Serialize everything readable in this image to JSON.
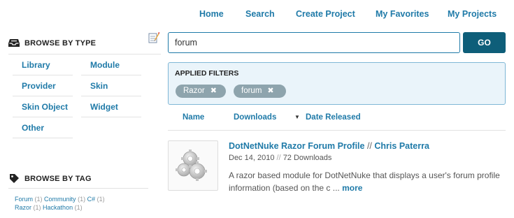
{
  "nav": {
    "home": "Home",
    "search": "Search",
    "create_project": "Create Project",
    "my_favorites": "My Favorites",
    "my_projects": "My Projects"
  },
  "sidebar": {
    "browse_by_type": "BROWSE BY TYPE",
    "types": [
      "Library",
      "Module",
      "Provider",
      "Skin",
      "Skin Object",
      "Widget",
      "Other"
    ],
    "browse_by_tag": "BROWSE BY TAG",
    "tags": [
      {
        "name": "Forum",
        "count": "(1)"
      },
      {
        "name": "Community",
        "count": "(1)"
      },
      {
        "name": "C#",
        "count": "(1)"
      },
      {
        "name": "Razor",
        "count": "(1)"
      },
      {
        "name": "Hackathon",
        "count": "(1)"
      }
    ]
  },
  "search": {
    "value": "forum",
    "go_label": "GO"
  },
  "filters": {
    "title": "APPLIED FILTERS",
    "chips": [
      "Razor",
      "forum"
    ],
    "remove_icon": "close-icon"
  },
  "sort": {
    "name": "Name",
    "downloads": "Downloads",
    "date_released": "Date Released",
    "active_indicator": "▼"
  },
  "result": {
    "title": "DotNetNuke Razor Forum Profile",
    "separator": "//",
    "author": "Chris Paterra",
    "date": "Dec 14, 2010",
    "meta_separator": "//",
    "downloads": "72 Downloads",
    "description": "A razor based module for DotNetNuke that displays a user's forum profile information (based on the c ...",
    "more": "more"
  },
  "colors": {
    "link": "#1f7aa8",
    "go_button": "#0e5e79",
    "filter_bg": "#eaf4fa",
    "chip_bg": "#8ea4ad"
  }
}
